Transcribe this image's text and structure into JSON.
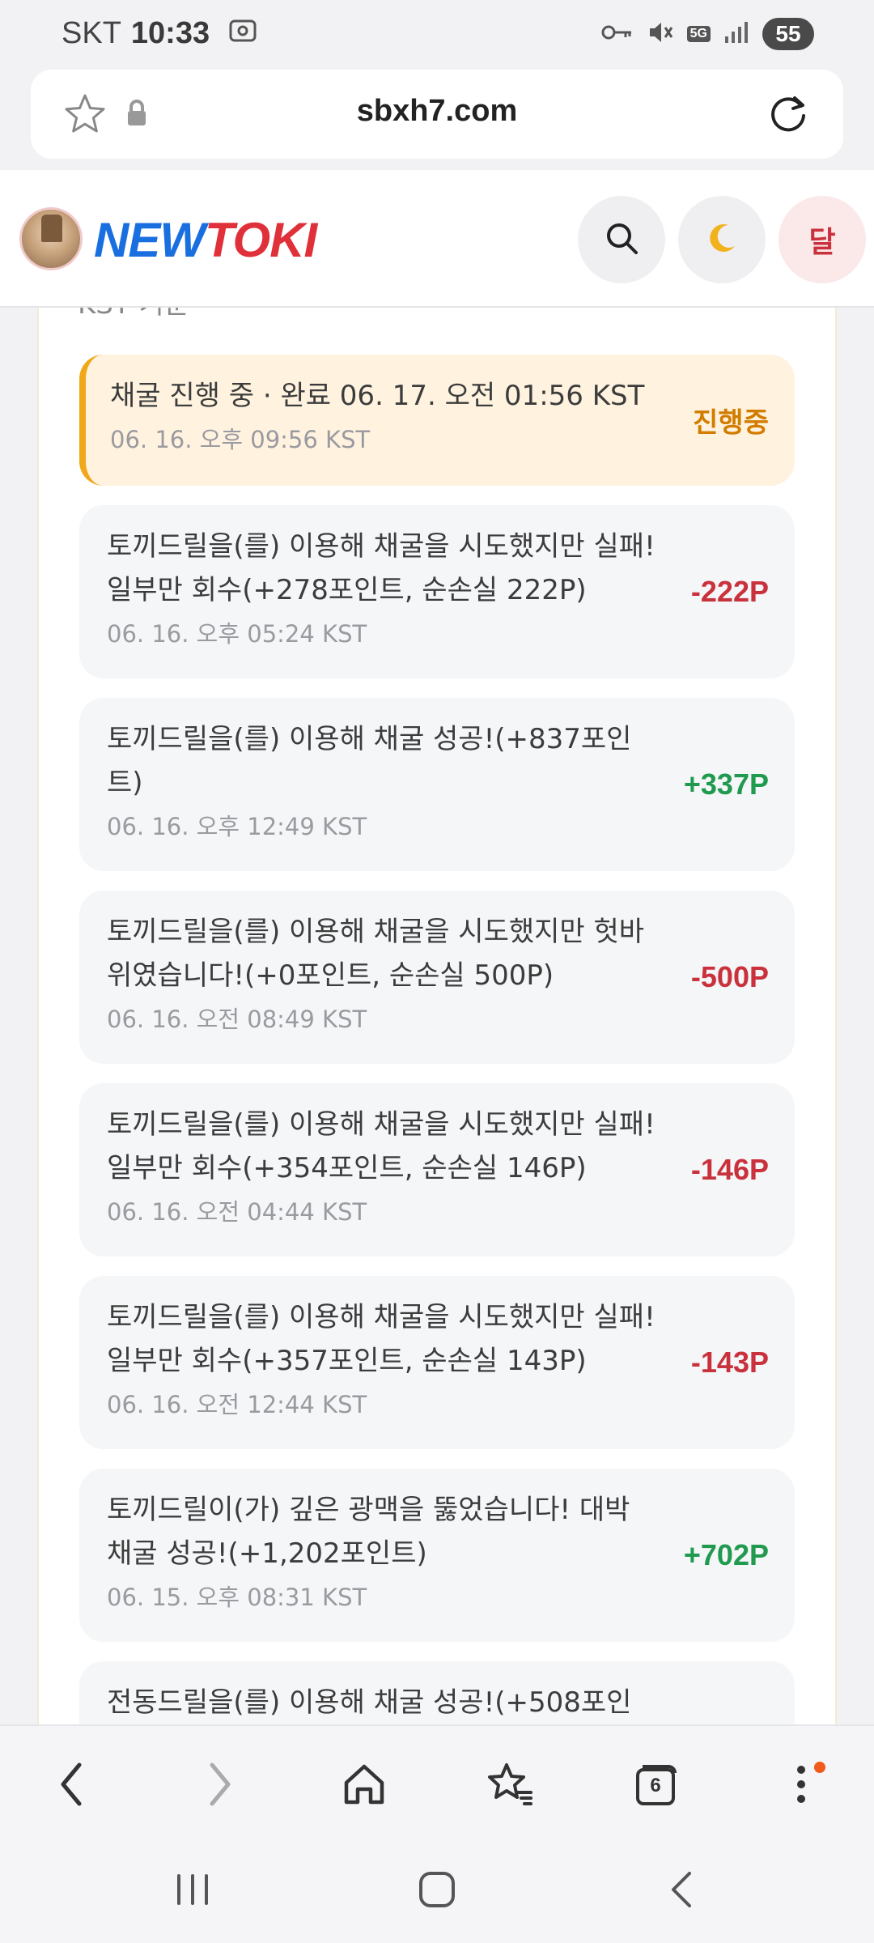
{
  "status_bar": {
    "carrier": "SKT",
    "time": "10:33",
    "network": "5G",
    "battery": "55"
  },
  "browser": {
    "url": "sbxh7.com",
    "tab_count": "6"
  },
  "header": {
    "logo_part1": "NEW",
    "logo_part2": "TOKI",
    "dal_label": "달"
  },
  "log": {
    "timezone_note": "KST 기준",
    "entries": [
      {
        "message": "채굴 진행 중 · 완료 06. 17. 오전 01:56 KST",
        "time": "06. 16. 오후 09:56 KST",
        "amount": "진행중",
        "kind": "progress"
      },
      {
        "message": "토끼드릴을(를) 이용해 채굴을 시도했지만 실패! 일부만 회수(+278포인트, 순손실 222P)",
        "time": "06. 16. 오후 05:24 KST",
        "amount": "-222P",
        "kind": "neg"
      },
      {
        "message": "토끼드릴을(를) 이용해 채굴 성공!(+837포인트)",
        "time": "06. 16. 오후 12:49 KST",
        "amount": "+337P",
        "kind": "pos"
      },
      {
        "message": "토끼드릴을(를) 이용해 채굴을 시도했지만 헛바위였습니다!(+0포인트, 순손실 500P)",
        "time": "06. 16. 오전 08:49 KST",
        "amount": "-500P",
        "kind": "neg"
      },
      {
        "message": "토끼드릴을(를) 이용해 채굴을 시도했지만 실패! 일부만 회수(+354포인트, 순손실 146P)",
        "time": "06. 16. 오전 04:44 KST",
        "amount": "-146P",
        "kind": "neg"
      },
      {
        "message": "토끼드릴을(를) 이용해 채굴을 시도했지만 실패! 일부만 회수(+357포인트, 순손실 143P)",
        "time": "06. 16. 오전 12:44 KST",
        "amount": "-143P",
        "kind": "neg"
      },
      {
        "message": "토끼드릴이(가) 깊은 광맥을 뚫었습니다! 대박 채굴 성공!(+1,202포인트)",
        "time": "06. 15. 오후 08:31 KST",
        "amount": "+702P",
        "kind": "pos"
      },
      {
        "message": "전동드릴을(를) 이용해 채굴 성공!(+508포인",
        "time": "",
        "amount": "",
        "kind": "pos"
      }
    ]
  }
}
